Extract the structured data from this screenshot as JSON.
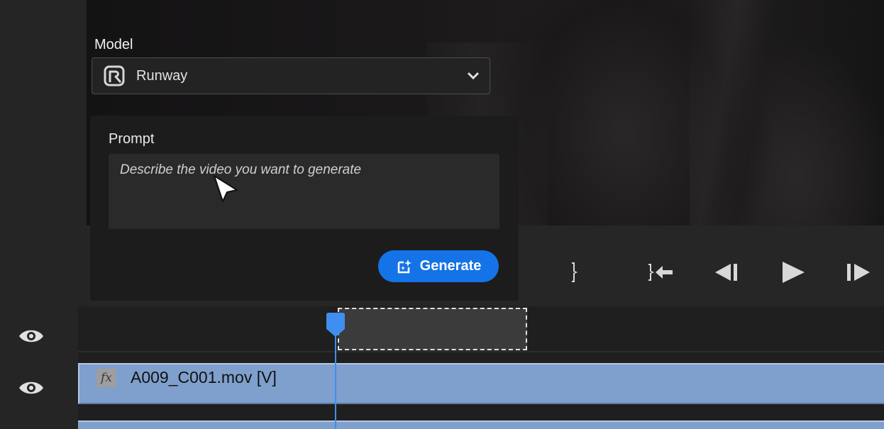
{
  "model": {
    "label": "Model",
    "value": "Runway",
    "icon": "runway-logo-icon"
  },
  "prompt": {
    "label": "Prompt",
    "placeholder": "Describe the video you want to generate",
    "generate_label": "Generate"
  },
  "transport": {
    "buttons": [
      "mark-out-icon",
      "go-to-in-icon",
      "step-back-icon",
      "play-icon",
      "step-forward-icon"
    ]
  },
  "timeline": {
    "clip_name": "A009_C001.mov [V]",
    "fx_badge": "fx"
  },
  "colors": {
    "accent": "#1473e6",
    "clip": "#7f9fcd",
    "playhead": "#3f8ef0"
  }
}
